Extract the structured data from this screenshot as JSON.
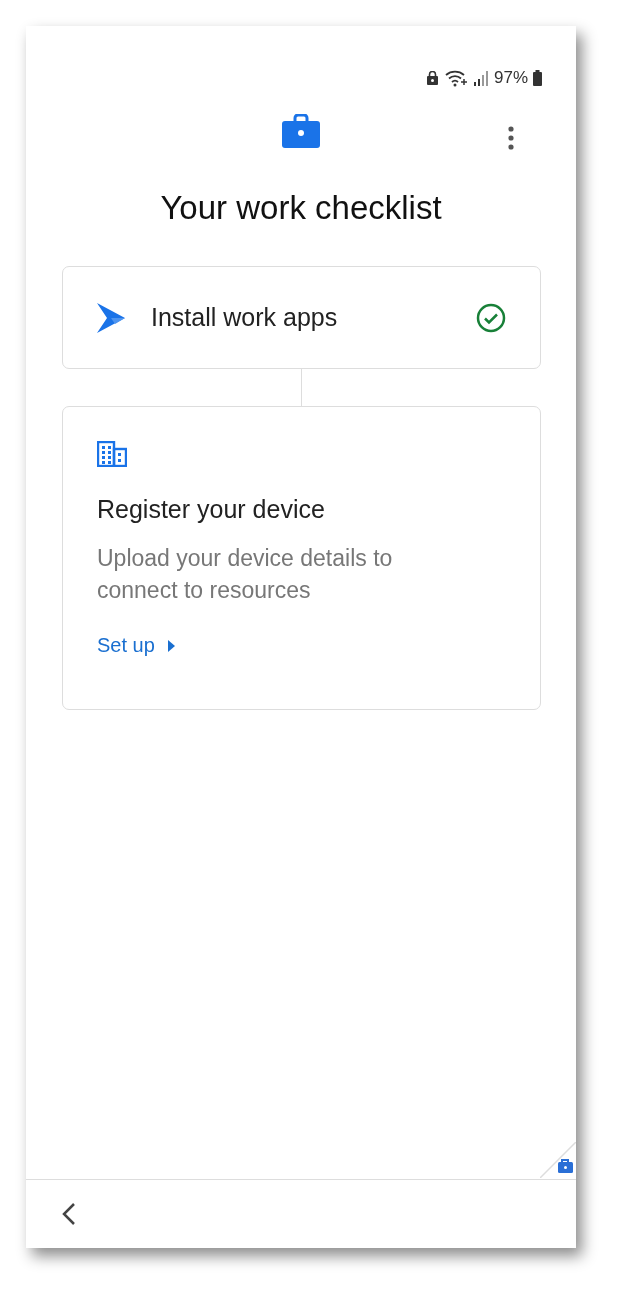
{
  "status_bar": {
    "battery": "97%"
  },
  "title": "Your work checklist",
  "tasks": [
    {
      "title": "Install work apps",
      "done": true
    },
    {
      "title": "Register your device",
      "description": "Upload your device details to connect to resources",
      "action": "Set up",
      "done": false
    }
  ]
}
